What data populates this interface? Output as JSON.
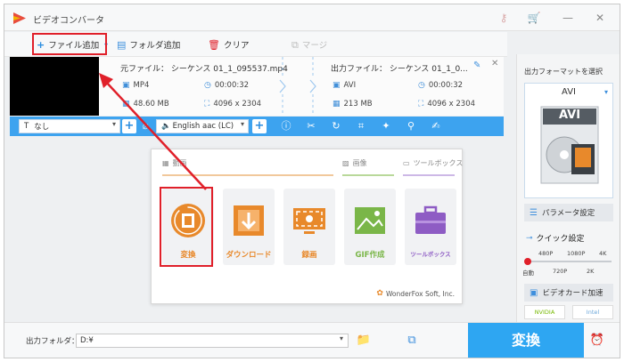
{
  "app": {
    "title": "ビデオコンバータ"
  },
  "toolbar": {
    "add_file": "ファイル追加",
    "add_folder": "フォルダ追加",
    "clear": "クリア",
    "merge": "マージ"
  },
  "file": {
    "source_name": "元ファイル： シーケンス 01_1_095537.mp4",
    "source_format": "MP4",
    "source_duration": "00:00:32",
    "source_size": "48.60 MB",
    "source_resolution": "4096 x 2304",
    "output_name": "出力ファイル： シーケンス 01_1_0...",
    "output_format": "AVI",
    "output_duration": "00:00:32",
    "output_size": "213 MB",
    "output_resolution": "4096 x 2304"
  },
  "editbar": {
    "subtitle": "なし",
    "audio": "English aac (LC)"
  },
  "popup": {
    "cat_video": "動画",
    "cat_image": "画像",
    "cat_toolbox": "ツールボックス",
    "tiles": [
      {
        "label": "変換",
        "color": "#e8892b"
      },
      {
        "label": "ダウンロード",
        "color": "#e8892b"
      },
      {
        "label": "録画",
        "color": "#e8892b"
      },
      {
        "label": "GIF作成",
        "color": "#7ab648"
      },
      {
        "label": "ツールボックス",
        "color": "#8e5cc4"
      }
    ],
    "brand": "WonderFox Soft, Inc."
  },
  "right_panel": {
    "title": "出力フォーマットを選択",
    "format": "AVI",
    "format_badge": "AVI",
    "params": "パラメータ設定",
    "quick": "クイック設定",
    "scale_top": [
      "480P",
      "1080P",
      "4K"
    ],
    "scale_bottom": [
      "自動",
      "720P",
      "2K"
    ],
    "gpu": "ビデオカード加速",
    "nvidia": "NVIDIA",
    "intel": "Intel"
  },
  "bottom": {
    "output_label": "出力フォルダ：",
    "output_path": "D:¥",
    "convert": "変換"
  },
  "colors": {
    "accent": "#3da3ef",
    "highlight": "#e0202a",
    "orange": "#e8892b"
  }
}
